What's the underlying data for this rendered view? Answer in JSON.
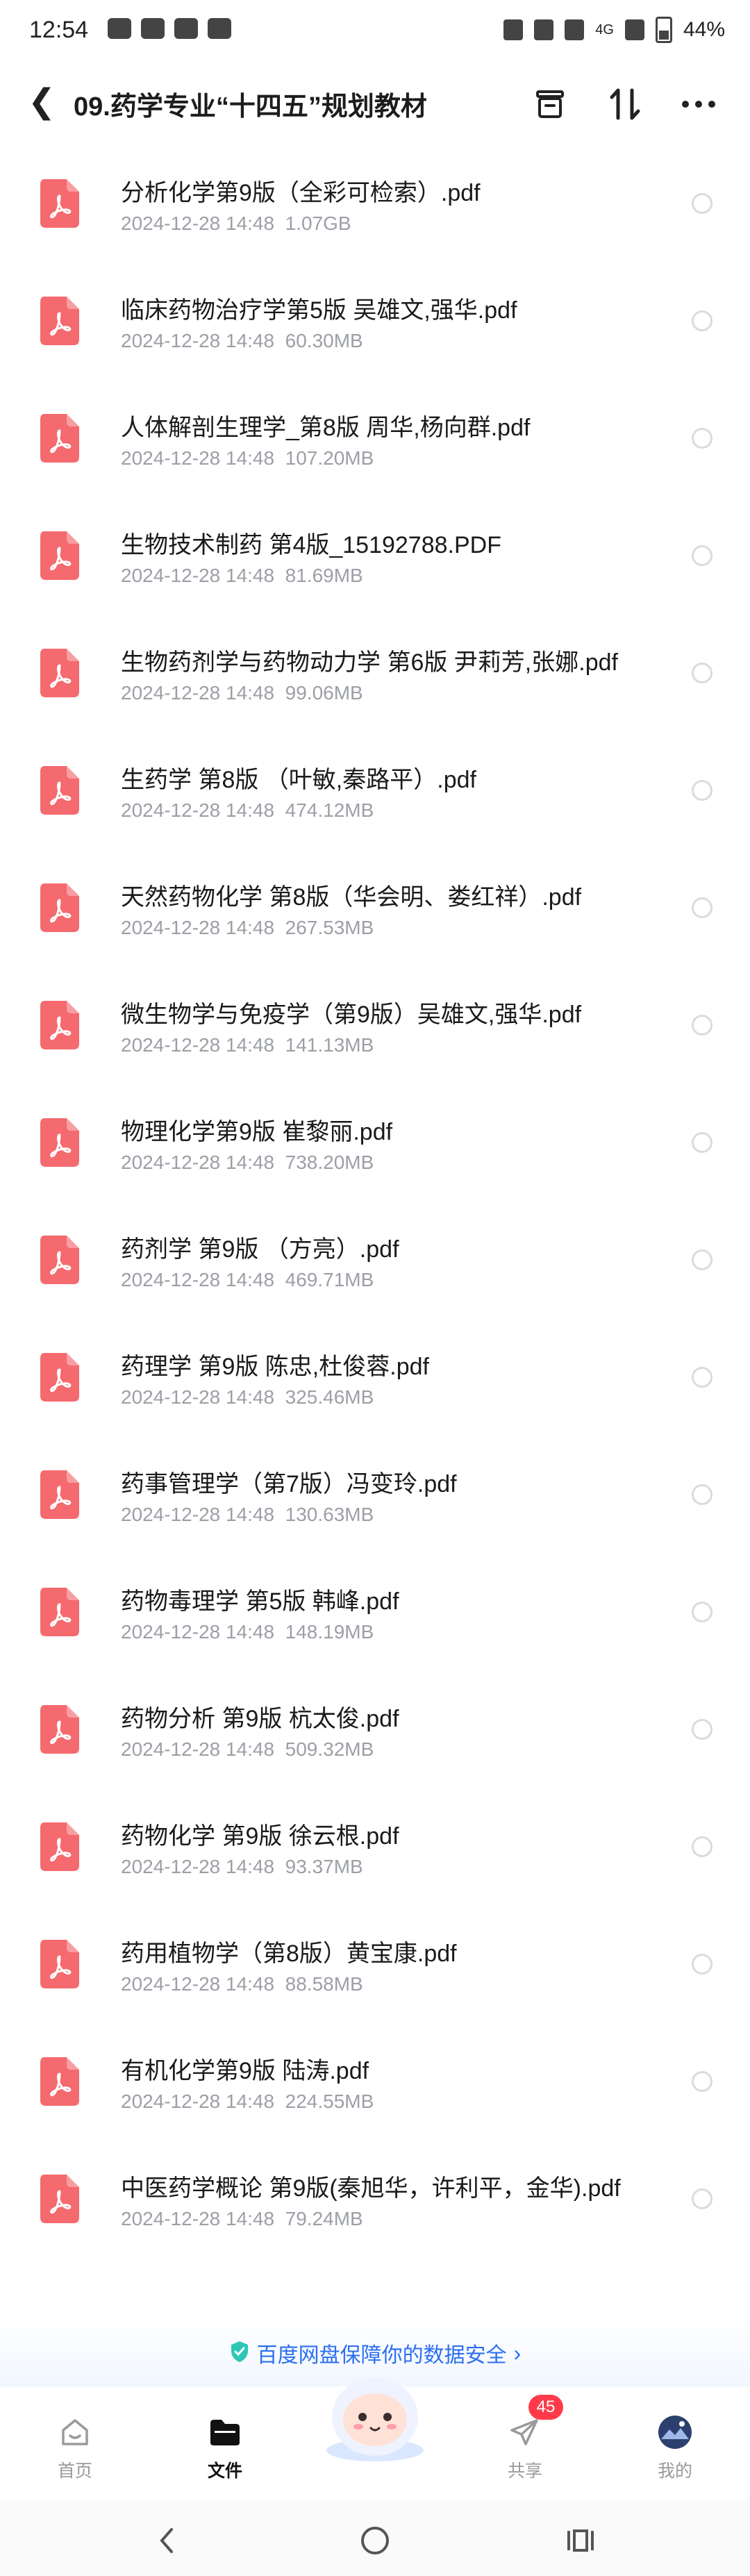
{
  "status_bar": {
    "time": "12:54",
    "network": "4G",
    "battery": "44%"
  },
  "header": {
    "title": "09.药学专业“十四五”规划教材"
  },
  "files": [
    {
      "name": "分析化学第9版（全彩可检索）.pdf",
      "date": "2024-12-28  14:48",
      "size": "1.07GB"
    },
    {
      "name": "临床药物治疗学第5版 吴雄文,强华.pdf",
      "date": "2024-12-28  14:48",
      "size": "60.30MB"
    },
    {
      "name": "人体解剖生理学_第8版 周华,杨向群.pdf",
      "date": "2024-12-28  14:48",
      "size": "107.20MB"
    },
    {
      "name": "生物技术制药  第4版_15192788.PDF",
      "date": "2024-12-28  14:48",
      "size": "81.69MB"
    },
    {
      "name": "生物药剂学与药物动力学 第6版 尹莉芳,张娜.pdf",
      "date": "2024-12-28  14:48",
      "size": "99.06MB"
    },
    {
      "name": "生药学 第8版 （叶敏,秦路平）.pdf",
      "date": "2024-12-28  14:48",
      "size": "474.12MB"
    },
    {
      "name": "天然药物化学 第8版（华会明、娄红祥）.pdf",
      "date": "2024-12-28  14:48",
      "size": "267.53MB"
    },
    {
      "name": "微生物学与免疫学（第9版）吴雄文,强华.pdf",
      "date": "2024-12-28  14:48",
      "size": "141.13MB"
    },
    {
      "name": "物理化学第9版 崔黎丽.pdf",
      "date": "2024-12-28  14:48",
      "size": "738.20MB"
    },
    {
      "name": "药剂学 第9版 （方亮）.pdf",
      "date": "2024-12-28  14:48",
      "size": "469.71MB"
    },
    {
      "name": "药理学 第9版 陈忠,杜俊蓉.pdf",
      "date": "2024-12-28  14:48",
      "size": "325.46MB"
    },
    {
      "name": "药事管理学（第7版）冯变玲.pdf",
      "date": "2024-12-28  14:48",
      "size": "130.63MB"
    },
    {
      "name": "药物毒理学 第5版 韩峰.pdf",
      "date": "2024-12-28  14:48",
      "size": "148.19MB"
    },
    {
      "name": "药物分析 第9版 杭太俊.pdf",
      "date": "2024-12-28  14:48",
      "size": "509.32MB"
    },
    {
      "name": "药物化学 第9版 徐云根.pdf",
      "date": "2024-12-28  14:48",
      "size": "93.37MB"
    },
    {
      "name": "药用植物学（第8版）黄宝康.pdf",
      "date": "2024-12-28  14:48",
      "size": "88.58MB"
    },
    {
      "name": "有机化学第9版 陆涛.pdf",
      "date": "2024-12-28  14:48",
      "size": "224.55MB"
    },
    {
      "name": "中医药学概论 第9版(秦旭华，许利平，金华).pdf",
      "date": "2024-12-28  14:48",
      "size": "79.24MB"
    }
  ],
  "safety_banner": {
    "text": "百度网盘保障你的数据安全"
  },
  "tabs": {
    "home": "首页",
    "files": "文件",
    "share": "共享",
    "mine": "我的",
    "share_badge": "45"
  },
  "colors": {
    "pdf_icon": "#f46a6f",
    "accent_blue": "#2a6ff0",
    "badge_red": "#ff3b4a"
  }
}
